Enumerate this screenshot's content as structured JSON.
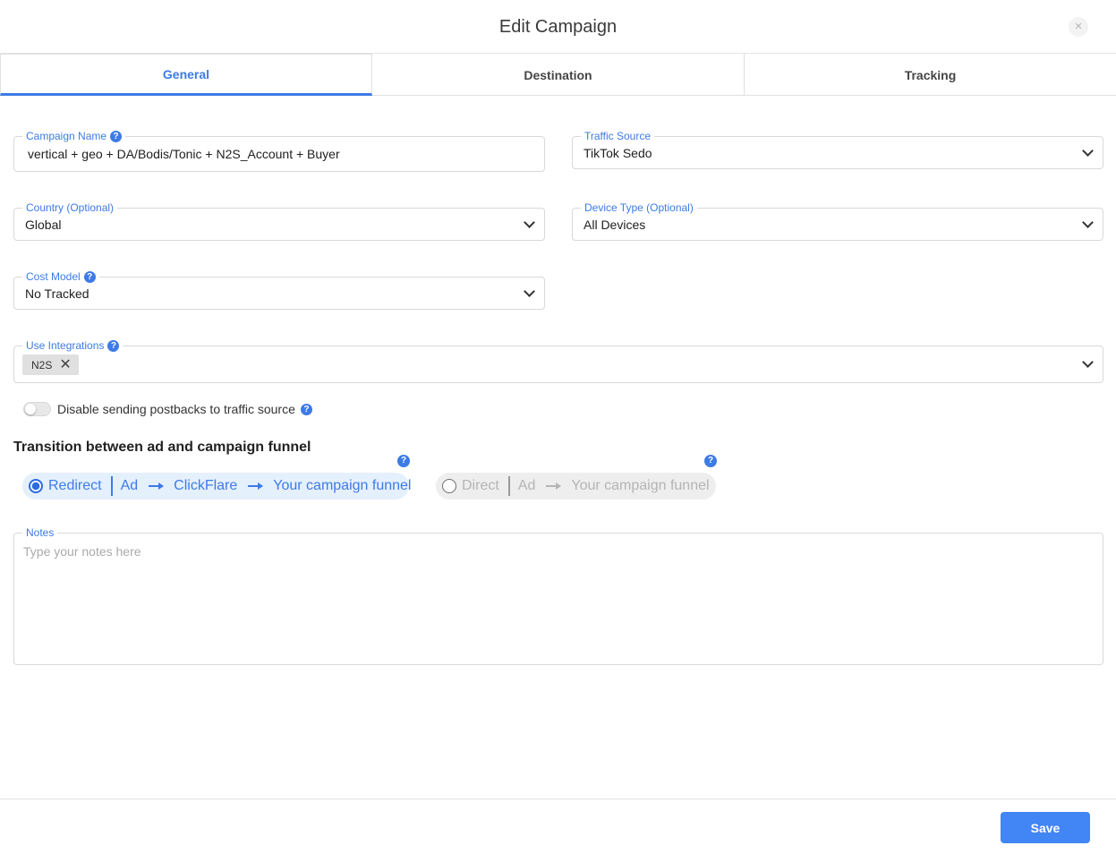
{
  "dialog": {
    "title": "Edit Campaign",
    "close_icon": "×"
  },
  "tabs": [
    {
      "label": "General",
      "active": true
    },
    {
      "label": "Destination",
      "active": false
    },
    {
      "label": "Tracking",
      "active": false
    }
  ],
  "form": {
    "campaign_name": {
      "label": "Campaign Name",
      "value": "vertical + geo + DA/Bodis/Tonic + N2S_Account + Buyer",
      "help_icon": "?"
    },
    "traffic_source": {
      "label": "Traffic Source",
      "value": "TikTok Sedo"
    },
    "country": {
      "label": "Country (Optional)",
      "value": "Global"
    },
    "device_type": {
      "label": "Device Type (Optional)",
      "value": "All Devices"
    },
    "cost_model": {
      "label": "Cost Model",
      "value": "No Tracked",
      "help_icon": "?"
    },
    "integrations": {
      "label": "Use Integrations",
      "chips": [
        {
          "label": "N2S",
          "remove_icon": "✕"
        }
      ],
      "help_icon": "?"
    },
    "postback_toggle": {
      "label": "Disable sending postbacks to traffic source",
      "enabled": false,
      "help_icon": "?"
    },
    "notes": {
      "label": "Notes",
      "placeholder": "Type your notes here",
      "value": ""
    }
  },
  "transition": {
    "title": "Transition between ad and campaign funnel",
    "redirect": {
      "label": "Redirect",
      "selected": true,
      "steps": [
        "Ad",
        "ClickFlare",
        "Your campaign funnel"
      ],
      "help_icon": "?"
    },
    "direct": {
      "label": "Direct",
      "selected": false,
      "steps": [
        "Ad",
        "Your campaign funnel"
      ],
      "help_icon": "?"
    }
  },
  "footer": {
    "save_label": "Save"
  },
  "colors": {
    "accent": "#3d7be6",
    "save_button": "#4285f4",
    "redirect_pill_bg": "#e5f0fd",
    "direct_pill_bg": "#eeeeee"
  }
}
